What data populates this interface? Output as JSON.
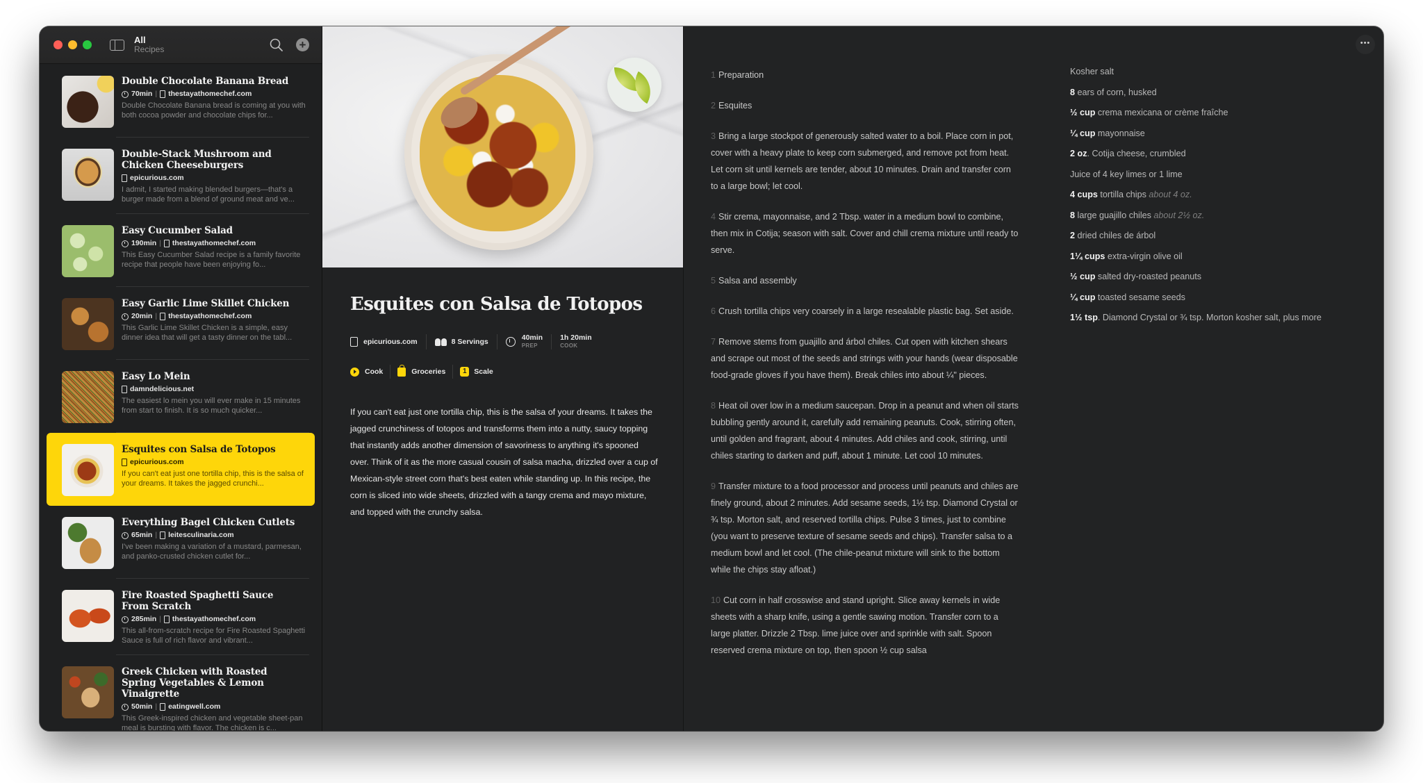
{
  "window": {
    "title": "All",
    "subtitle": "Recipes",
    "more_label": "•••"
  },
  "sidebar": {
    "add_label": "+",
    "items": [
      {
        "title": "Double Chocolate Banana Bread",
        "time": "70min",
        "source": "thestayathomechef.com",
        "desc": "Double Chocolate Banana bread is coming at you with both cocoa powder and chocolate chips for...",
        "thumb": "bread",
        "selected": false
      },
      {
        "title": "Double-Stack Mushroom and Chicken Cheeseburgers",
        "time": "",
        "source": "epicurious.com",
        "desc": "I admit, I started making blended burgers—that's a burger made from a blend of ground meat and ve...",
        "thumb": "burger",
        "selected": false
      },
      {
        "title": "Easy Cucumber Salad",
        "time": "190min",
        "source": "thestayathomechef.com",
        "desc": "This Easy Cucumber Salad recipe is a family favorite recipe that people have been enjoying fo...",
        "thumb": "cucumber",
        "selected": false
      },
      {
        "title": "Easy Garlic Lime Skillet Chicken",
        "time": "20min",
        "source": "thestayathomechef.com",
        "desc": "This Garlic Lime Skillet Chicken is a simple, easy dinner idea that will get a tasty dinner on the tabl...",
        "thumb": "chicken",
        "selected": false
      },
      {
        "title": "Easy Lo Mein",
        "time": "",
        "source": "damndelicious.net",
        "desc": "The easiest lo mein you will ever make in 15 minutes from start to finish. It is so much quicker...",
        "thumb": "lomein",
        "selected": false
      },
      {
        "title": "Esquites con Salsa de Totopos",
        "time": "",
        "source": "epicurious.com",
        "desc": "If you can't eat just one tortilla chip, this is the salsa of your dreams. It takes the jagged crunchi...",
        "thumb": "esquites",
        "selected": true
      },
      {
        "title": "Everything Bagel Chicken Cutlets",
        "time": "65min",
        "source": "leitesculinaria.com",
        "desc": "I've been making a variation of a mustard, parmesan, and panko-crusted chicken cutlet for...",
        "thumb": "cutlet",
        "selected": false
      },
      {
        "title": "Fire Roasted Spaghetti Sauce From Scratch",
        "time": "285min",
        "source": "thestayathomechef.com",
        "desc": "This all-from-scratch recipe for Fire Roasted Spaghetti Sauce is full of rich flavor and vibrant...",
        "thumb": "sauce",
        "selected": false
      },
      {
        "title": "Greek Chicken with Roasted Spring Vegetables & Lemon Vinaigrette",
        "time": "50min",
        "source": "eatingwell.com",
        "desc": "This Greek-inspired chicken and vegetable sheet-pan meal is bursting with flavor. The chicken is c...",
        "thumb": "greek",
        "selected": false
      }
    ]
  },
  "detail": {
    "title": "Esquites con Salsa de Totopos",
    "source": "epicurious.com",
    "servings": "8 Servings",
    "prep_time": "40min",
    "prep_label": "PREP",
    "cook_time": "1h 20min",
    "cook_label": "COOK",
    "actions": {
      "cook": "Cook",
      "groceries": "Groceries",
      "scale_value": "1",
      "scale": "Scale"
    },
    "intro": "If you can't eat just one tortilla chip, this is the salsa of your dreams. It takes the jagged crunchiness of totopos and transforms them into a nutty, saucy topping that instantly adds another dimension of savoriness to anything it's spooned over. Think of it as the more casual cousin of salsa macha, drizzled over a cup of Mexican-style street corn that's best eaten while standing up. In this recipe, the corn is sliced into wide sheets, drizzled with a tangy crema and mayo mixture, and topped with the crunchy salsa."
  },
  "instructions": [
    {
      "num": "1",
      "text": "Preparation"
    },
    {
      "num": "2",
      "text": "Esquites"
    },
    {
      "num": "3",
      "text": "Bring a large stockpot of generously salted water to a boil. Place corn in pot, cover with a heavy plate to keep corn submerged, and remove pot from heat. Let corn sit until kernels are tender, about 10 minutes. Drain and transfer corn to a large bowl; let cool."
    },
    {
      "num": "4",
      "text": "Stir crema, mayonnaise, and 2 Tbsp. water in a medium bowl to combine, then mix in Cotija; season with salt. Cover and chill crema mixture until ready to serve."
    },
    {
      "num": "5",
      "text": "Salsa and assembly"
    },
    {
      "num": "6",
      "text": "Crush tortilla chips very coarsely in a large resealable plastic bag. Set aside."
    },
    {
      "num": "7",
      "text": "Remove stems from guajillo and árbol chiles. Cut open with kitchen shears and scrape out most of the seeds and strings with your hands (wear disposable food-grade gloves if you have them). Break chiles into about ¼\" pieces."
    },
    {
      "num": "8",
      "text": "Heat oil over low in a medium saucepan. Drop in a peanut and when oil starts bubbling gently around it, carefully add remaining peanuts. Cook, stirring often, until golden and fragrant, about 4 minutes. Add chiles and cook, stirring, until chiles starting to darken and puff, about 1 minute. Let cool 10 minutes."
    },
    {
      "num": "9",
      "text": "Transfer mixture to a food processor and process until peanuts and chiles are finely ground, about 2 minutes. Add sesame seeds, 1½ tsp. Diamond Crystal or ¾ tsp. Morton salt, and reserved tortilla chips. Pulse 3 times, just to combine (you want to preserve texture of sesame seeds and chips). Transfer salsa to a medium bowl and let cool. (The chile-peanut mixture will sink to the bottom while the chips stay afloat.)"
    },
    {
      "num": "10",
      "text": "Cut corn in half crosswise and stand upright. Slice away kernels in wide sheets with a sharp knife, using a gentle sawing motion. Transfer corn to a large platter. Drizzle 2 Tbsp. lime juice over and sprinkle with salt. Spoon reserved crema mixture on top, then spoon ½ cup salsa"
    }
  ],
  "ingredients": [
    {
      "qty": "",
      "text": "Kosher salt",
      "note": ""
    },
    {
      "qty": "8",
      "text": " ears of corn, husked",
      "note": ""
    },
    {
      "qty": "½ cup",
      "text": " crema mexicana or crème fraîche",
      "note": ""
    },
    {
      "qty": "¼ cup",
      "text": " mayonnaise",
      "note": ""
    },
    {
      "qty": "2 oz",
      "text": ". Cotija cheese, crumbled",
      "note": ""
    },
    {
      "qty": "",
      "text": "Juice of 4 key limes or 1 lime",
      "note": ""
    },
    {
      "qty": "4 cups",
      "text": " tortilla chips ",
      "note": "about 4 oz."
    },
    {
      "qty": "8",
      "text": " large guajillo chiles ",
      "note": "about 2½ oz."
    },
    {
      "qty": "2",
      "text": " dried chiles de árbol",
      "note": ""
    },
    {
      "qty": "1¼ cups",
      "text": " extra-virgin olive oil",
      "note": ""
    },
    {
      "qty": "½ cup",
      "text": " salted dry-roasted peanuts",
      "note": ""
    },
    {
      "qty": "¼ cup",
      "text": " toasted sesame seeds",
      "note": ""
    },
    {
      "qty": "1½ tsp",
      "text": ". Diamond Crystal or ¾ tsp. Morton kosher salt, plus more",
      "note": ""
    }
  ],
  "colors": {
    "accent": "#fed60a",
    "window_bg": "#222324",
    "sidebar_bg": "#1f2021"
  }
}
